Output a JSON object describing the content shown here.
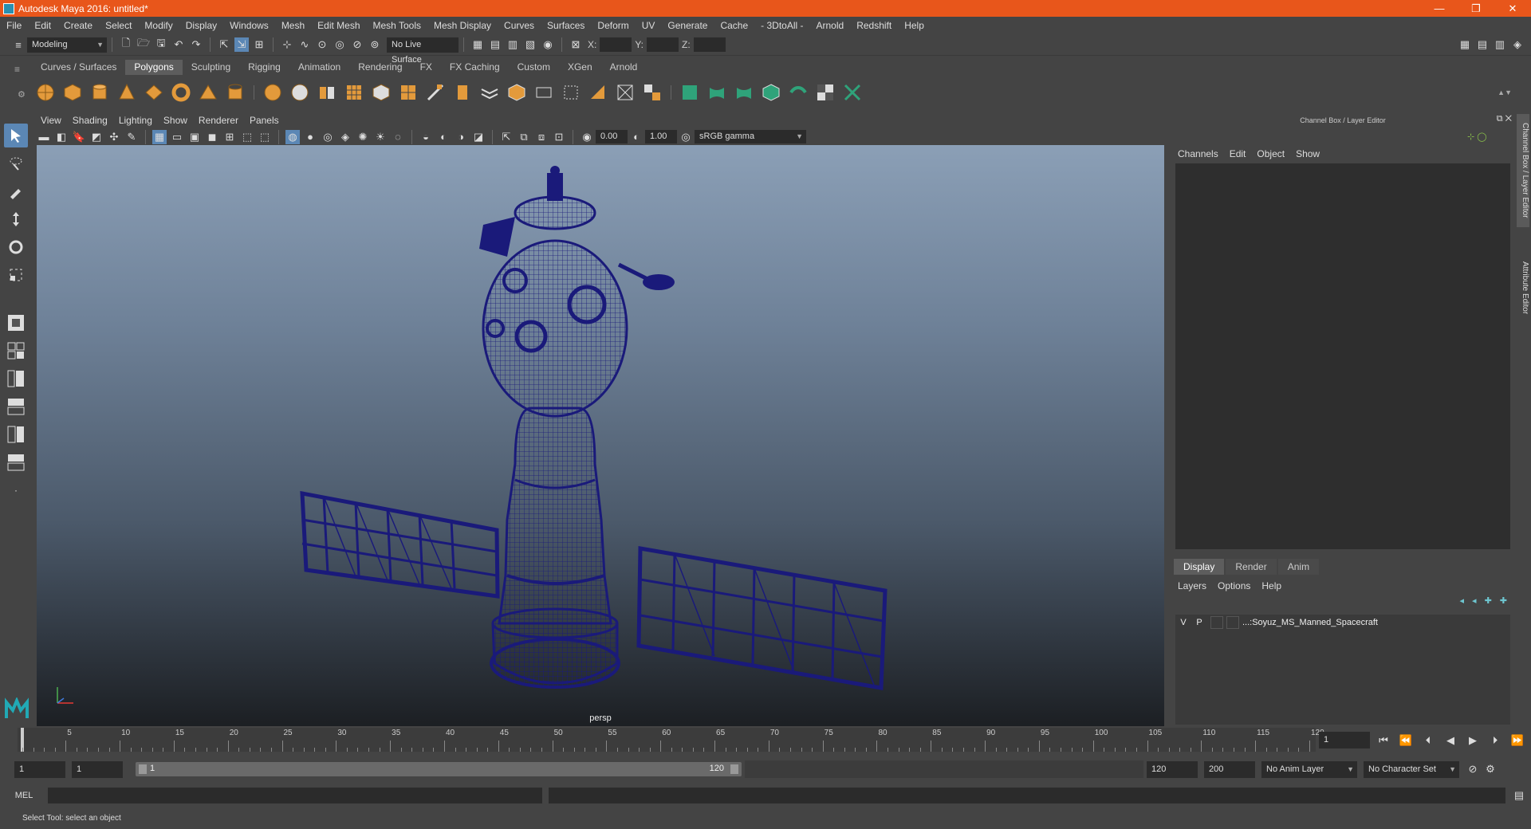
{
  "window": {
    "title": "Autodesk Maya 2016: untitled*",
    "minimize": "—",
    "restore": "❐",
    "close": "✕"
  },
  "menubar": [
    "File",
    "Edit",
    "Create",
    "Select",
    "Modify",
    "Display",
    "Windows",
    "Mesh",
    "Edit Mesh",
    "Mesh Tools",
    "Mesh Display",
    "Curves",
    "Surfaces",
    "Deform",
    "UV",
    "Generate",
    "Cache",
    "- 3DtoAll -",
    "Arnold",
    "Redshift",
    "Help"
  ],
  "statusline": {
    "mode": "Modeling",
    "live_surface": "No Live Surface",
    "x_label": "X:",
    "y_label": "Y:",
    "z_label": "Z:"
  },
  "shelf": {
    "tabs": [
      "Curves / Surfaces",
      "Polygons",
      "Sculpting",
      "Rigging",
      "Animation",
      "Rendering",
      "FX",
      "FX Caching",
      "Custom",
      "XGen",
      "Arnold"
    ],
    "active_tab": "Polygons"
  },
  "viewport": {
    "menu": [
      "View",
      "Shading",
      "Lighting",
      "Show",
      "Renderer",
      "Panels"
    ],
    "exposure": "0.00",
    "gamma": "1.00",
    "colorspace": "sRGB gamma",
    "camera": "persp",
    "wire_color": "#1a1a7a"
  },
  "channelbox": {
    "header": "Channel Box / Layer Editor",
    "menu": [
      "Channels",
      "Edit",
      "Object",
      "Show"
    ],
    "layer_tabs": [
      "Display",
      "Render",
      "Anim"
    ],
    "active_layer_tab": "Display",
    "layer_menu": [
      "Layers",
      "Options",
      "Help"
    ],
    "layers": [
      {
        "v": "V",
        "p": "P",
        "name": "...:Soyuz_MS_Manned_Spacecraft"
      }
    ],
    "side_tabs": [
      "Channel Box / Layer Editor",
      "Attribute Editor"
    ]
  },
  "timeline": {
    "ticks": [
      "5",
      "10",
      "15",
      "20",
      "25",
      "30",
      "35",
      "40",
      "45",
      "50",
      "55",
      "60",
      "65",
      "70",
      "75",
      "80",
      "85",
      "90",
      "95",
      "100",
      "105",
      "110",
      "115",
      "120"
    ],
    "first_label": "1",
    "current_frame": "1",
    "range_start": "1",
    "range_start2": "1",
    "range_bar_start": "1",
    "range_bar_end": "120",
    "range_end": "120",
    "anim_end": "200",
    "anim_layer": "No Anim Layer",
    "character_set": "No Character Set"
  },
  "cmdline": {
    "label": "MEL"
  },
  "helpline": {
    "text": "Select Tool: select an object"
  }
}
